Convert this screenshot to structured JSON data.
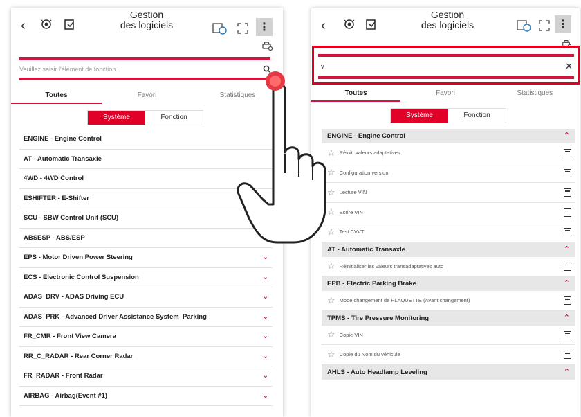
{
  "header": {
    "back": "‹",
    "title_line1": "Gestion",
    "title_line2": "des logiciels",
    "kebab": "⋮"
  },
  "left": {
    "search_placeholder": "Veuillez saisir l'élément de fonction.",
    "tabs": [
      "Toutes",
      "Favori",
      "Statistiques"
    ],
    "segment": [
      "Système",
      "Fonction"
    ],
    "items": [
      "ENGINE - Engine Control",
      "AT - Automatic Transaxle",
      "4WD - 4WD Control",
      "ESHIFTER - E-Shifter",
      "SCU - SBW Control Unit (SCU)",
      "ABSESP - ABS/ESP",
      "EPS - Motor Driven Power Steering",
      "ECS - Electronic Control Suspension",
      "ADAS_DRV - ADAS Driving ECU",
      "ADAS_PRK - Advanced Driver Assistance System_Parking",
      "FR_CMR - Front View Camera",
      "RR_C_RADAR - Rear Corner Radar",
      "FR_RADAR - Front Radar",
      "AIRBAG - Airbag(Event #1)"
    ],
    "chevron": "⌄"
  },
  "right": {
    "search_value": "v",
    "clear": "✕",
    "tabs": [
      "Toutes",
      "Favori",
      "Statistiques"
    ],
    "segment": [
      "Système",
      "Fonction"
    ],
    "groups": [
      {
        "name": "ENGINE - Engine Control",
        "subs": [
          "Réinit. valeurs adaptatives",
          "Configuration version",
          "Lecture VIN",
          "Ecrire VIN",
          "Test CVVT"
        ]
      },
      {
        "name": "AT - Automatic Transaxle",
        "subs": [
          "Réinitialiser les valeurs transadaptatives auto"
        ]
      },
      {
        "name": "EPB - Electric Parking Brake",
        "subs": [
          "Mode changement de PLAQUETTE (Avant changement)"
        ]
      },
      {
        "name": "TPMS - Tire Pressure Monitoring",
        "subs": [
          "Copie VIN",
          "Copie du Nom du véhicule"
        ]
      },
      {
        "name": "AHLS - Auto Headlamp Leveling",
        "subs": []
      }
    ],
    "chevron_up": "⌃",
    "star": "☆"
  },
  "colors": {
    "accent": "#d4143c",
    "segment_on": "#e00028",
    "group_bg": "#e7e7e7"
  }
}
